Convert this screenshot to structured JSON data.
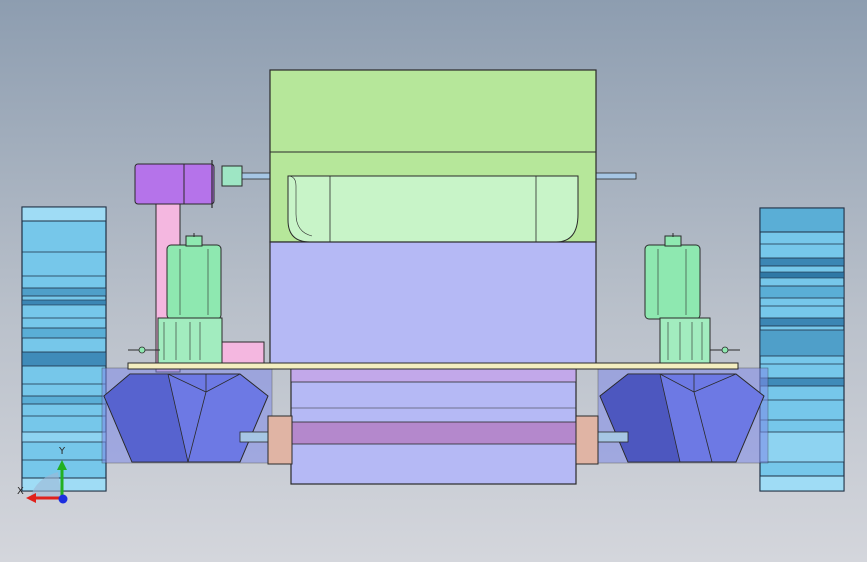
{
  "viewport": {
    "background_top": "#8d9db0",
    "background_bottom": "#d4d6dc"
  },
  "triad": {
    "x_label": "X",
    "y_label": "Y",
    "x_color": "#e0201c",
    "y_color": "#22b022",
    "z_color": "#1c2ee0"
  },
  "parts": {
    "upper_body_color": "#b6e79a",
    "lower_body_color": "#b5b9f5",
    "window_color": "#c8f4c8",
    "motor_purple_color": "#b573ea",
    "motor_green_color": "#8ee8b0",
    "wheel_color": "#76c7ea",
    "funnel_color": "#6d79e4",
    "plate_color": "#f3eec0",
    "bracket_pink_color": "#f4b7e0",
    "shaft_tan_color": "#e0b4a4"
  }
}
